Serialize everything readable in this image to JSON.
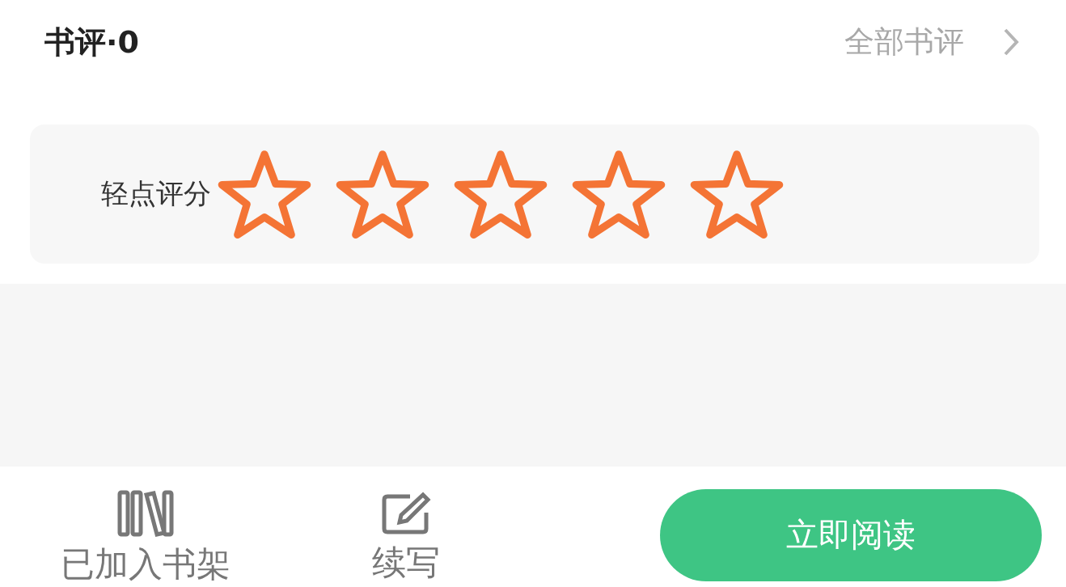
{
  "header": {
    "title": "书评·0",
    "link": "全部书评"
  },
  "rating": {
    "label": "轻点评分",
    "stars": 0
  },
  "bottom_bar": {
    "actions": [
      {
        "kind": "shelf",
        "label": "已加入书架"
      },
      {
        "kind": "write",
        "label": "续写"
      }
    ],
    "button": "立即阅读"
  }
}
